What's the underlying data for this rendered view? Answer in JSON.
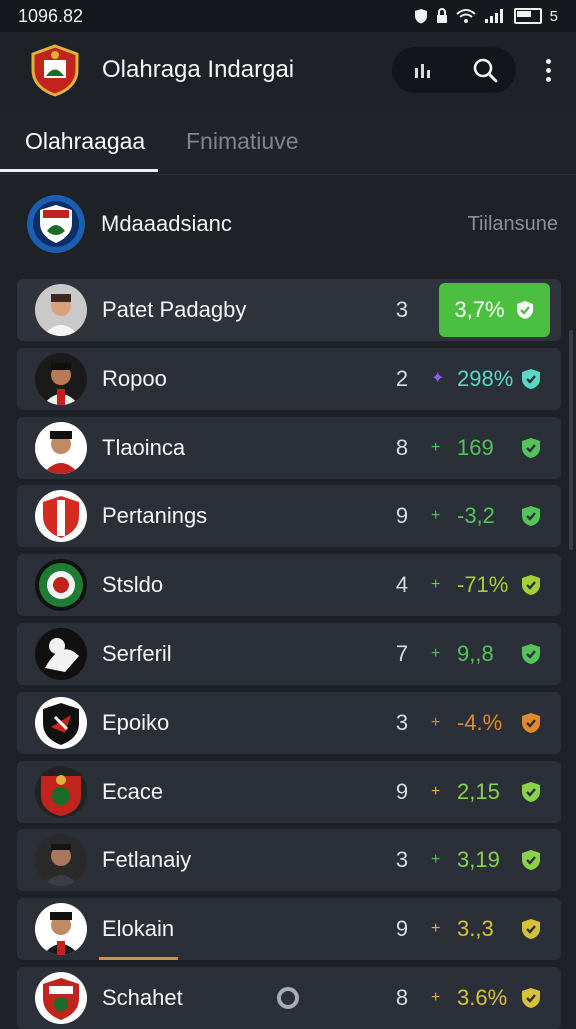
{
  "status_bar": {
    "time": "1096.82",
    "battery_text": "5"
  },
  "app_bar": {
    "title": "Olahraga Indargai"
  },
  "tabs": [
    {
      "label": "Olahraagaa",
      "active": true
    },
    {
      "label": "Fnimatiuve",
      "active": false
    }
  ],
  "group": {
    "title": "Mdaaadsianc",
    "aside": "Tiilansune"
  },
  "rows": [
    {
      "name": "Patet Padagby",
      "rank": "3",
      "change": "3,7%",
      "trend": "",
      "highlight": true,
      "color": "#4bbf3f"
    },
    {
      "name": "Ropoo",
      "rank": "2",
      "change": "298%",
      "trend": "✦",
      "trend_color": "#8c5cf0",
      "color": "#5ad8c6"
    },
    {
      "name": "Tlaoinca",
      "rank": "8",
      "change": "169",
      "trend": "+",
      "trend_color": "#54c45a",
      "color": "#54c45a"
    },
    {
      "name": "Pertanings",
      "rank": "9",
      "change": "-3,2",
      "trend": "+",
      "trend_color": "#54c45a",
      "color": "#54c45a"
    },
    {
      "name": "Stsldo",
      "rank": "4",
      "change": "-71%",
      "trend": "+",
      "trend_color": "#7cc43a",
      "color": "#a4cf38"
    },
    {
      "name": "Serferil",
      "rank": "7",
      "change": "9,,8",
      "trend": "+",
      "trend_color": "#54c45a",
      "color": "#54c45a"
    },
    {
      "name": "Epoiko",
      "rank": "3",
      "change": "-4.%",
      "trend": "+",
      "trend_color": "#e08a2c",
      "color": "#e08a2c"
    },
    {
      "name": "Ecace",
      "rank": "9",
      "change": "2,15",
      "trend": "+",
      "trend_color": "#e6b03a",
      "color": "#8ad24a"
    },
    {
      "name": "Fetlanaiy",
      "rank": "3",
      "change": "3,19",
      "trend": "+",
      "trend_color": "#54c45a",
      "color": "#8ad24a"
    },
    {
      "name": "Elokain",
      "rank": "9",
      "change": "3.,3",
      "trend": "+",
      "trend_color": "#e6b03a",
      "color": "#d6c23a"
    },
    {
      "name": "Schahet",
      "rank": "8",
      "change": "3.6%",
      "trend": "+",
      "trend_color": "#e6b03a",
      "color": "#d6c23a"
    }
  ]
}
